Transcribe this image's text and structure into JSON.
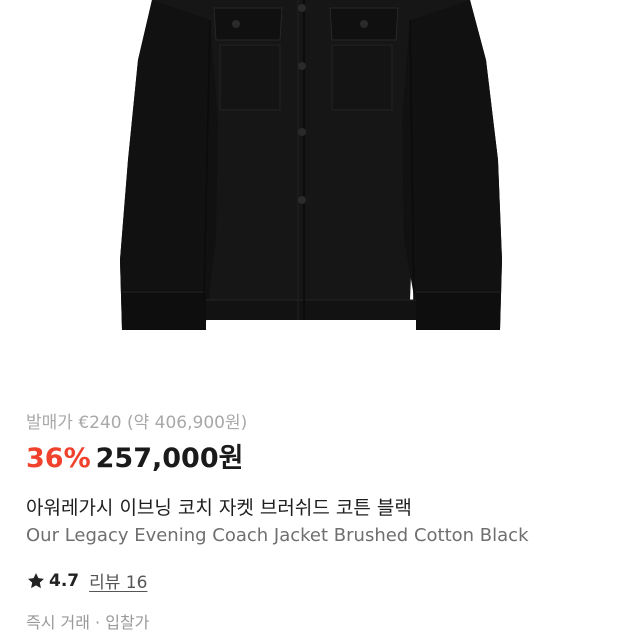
{
  "product": {
    "image_alt": "Our Legacy Evening Coach Jacket Brushed Cotton Black",
    "retail_price_text": "발매가 €240 (약 406,900원)",
    "discount_text": "36%",
    "price_text": "257,000원",
    "name_ko": "아워레가시 이브닝 코치 자켓 브러쉬드 코튼 블랙",
    "name_en": "Our Legacy Evening Coach Jacket Brushed Cotton Black",
    "rating_icon": "star-icon",
    "rating_text": "4.7",
    "reviews_text": "리뷰 16",
    "cutoff_text": "즉시 거래 · 입찰가"
  },
  "colors": {
    "discount": "#f0412d",
    "price": "#1a1a1a",
    "jacket": "#161616"
  }
}
